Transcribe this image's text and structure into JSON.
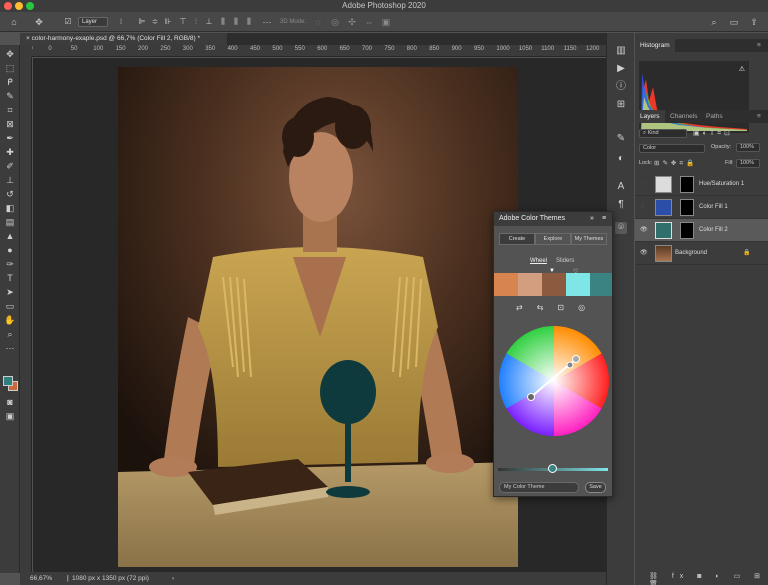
{
  "window": {
    "title": "Adobe Photoshop 2020"
  },
  "options_bar": {
    "home_icon": "home-icon",
    "move_icon": "move-icon",
    "auto_select_value": "Layer",
    "mode_3d_label": "3D Mode:"
  },
  "document": {
    "tab_title": "color-harmony-exaple.psd @ 66,7% (Color Fill 2, RGB/8) *",
    "close_glyph": "×"
  },
  "ruler": {
    "marks": [
      "50",
      "0",
      "50",
      "100",
      "150",
      "200",
      "250",
      "300",
      "350",
      "400",
      "450",
      "500",
      "550",
      "600",
      "650",
      "700",
      "750",
      "800",
      "850",
      "900",
      "950",
      "1000",
      "1050",
      "1100",
      "1150",
      "1200"
    ]
  },
  "status": {
    "zoom": "66,67%",
    "doc_info": "1080 px x 1350 px (72 ppi)"
  },
  "panels": {
    "histogram_tab": "Histogram",
    "layers_tabs": [
      "Layers",
      "Channels",
      "Paths"
    ],
    "filter_kind": "Kind",
    "blend_mode": "Color",
    "opacity_label": "Opacity:",
    "opacity_value": "100%",
    "lock_label": "Lock:",
    "fill_label": "Fill:",
    "fill_value": "100%",
    "layers": [
      {
        "name": "Hue/Saturation 1",
        "visible": false,
        "thumb": "#dcdcdc"
      },
      {
        "name": "Color Fill 1",
        "visible": false,
        "thumb": "#2b4fa8"
      },
      {
        "name": "Color Fill 2",
        "visible": true,
        "thumb": "#2f6f6c",
        "selected": true
      },
      {
        "name": "Background",
        "visible": true,
        "thumb": "#7a5030"
      }
    ]
  },
  "color_themes": {
    "title": "Adobe Color Themes",
    "segments": [
      "Create",
      "Explore",
      "My Themes"
    ],
    "sub_tabs": [
      "Wheel",
      "Sliders"
    ],
    "swatches": [
      "#d7844f",
      "#d39e80",
      "#8b5a3f",
      "#7fe6e8",
      "#3b8283"
    ],
    "name_placeholder": "My Color Theme",
    "save_label": "Save"
  },
  "colors": {
    "foreground": "#2f7f7d",
    "background": "#c96a3c"
  }
}
